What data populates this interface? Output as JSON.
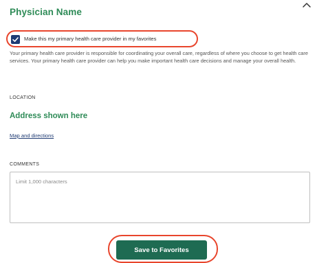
{
  "physician": {
    "name": "Physician Name"
  },
  "icons": {
    "collapse": "chevron-up-icon",
    "checkbox": "checkmark-icon"
  },
  "primary_provider": {
    "checked": true,
    "label": "Make this my primary health care provider in my favorites",
    "description": "Your primary health care provider is responsible for coordinating your overall care, regardless of where you choose to get health care services. Your primary health care provider can help you make important health care decisions and manage your overall health."
  },
  "location": {
    "heading": "LOCATION",
    "address": "Address shown here",
    "map_link": "Map and directions"
  },
  "comments": {
    "heading": "COMMENTS",
    "value": "",
    "placeholder": "Limit 1,000 characters"
  },
  "actions": {
    "save_label": "Save to Favorites"
  },
  "colors": {
    "brand_green": "#2e8b57",
    "button_green": "#1e6b52",
    "checkbox_navy": "#1f3b73",
    "highlight_red": "#e8452c",
    "link_blue": "#1f3b73"
  }
}
